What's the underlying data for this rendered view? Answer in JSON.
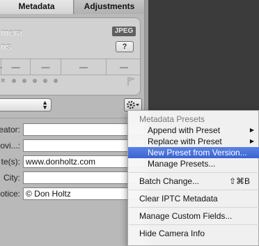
{
  "tabs": {
    "metadata": "Metadata",
    "adjustments": "Adjustments"
  },
  "camera_info": {
    "name_fragment": "mera",
    "sub_fragment": "ns",
    "badge": "JPEG",
    "help": "?",
    "stats": [
      "—",
      "—",
      "—",
      "—",
      "—"
    ],
    "reject": "×"
  },
  "fields": [
    {
      "label": "eator:",
      "value": ""
    },
    {
      "label": "ovi...:",
      "value": ""
    },
    {
      "label": "te(s):",
      "value": "www.donholtz.com"
    },
    {
      "label": "City:",
      "value": ""
    },
    {
      "label": "otice:",
      "value": "© Don Holtz"
    }
  ],
  "menu": {
    "header": "Metadata Presets",
    "append": "Append with Preset",
    "replace": "Replace with Preset",
    "new_from_version": "New Preset from Version...",
    "manage_presets": "Manage Presets...",
    "batch_change": "Batch Change...",
    "batch_shortcut": "⇧⌘B",
    "clear_iptc": "Clear IPTC Metadata",
    "manage_custom": "Manage Custom Fields...",
    "hide_camera": "Hide Camera Info",
    "submenu_arrow": "▶"
  }
}
